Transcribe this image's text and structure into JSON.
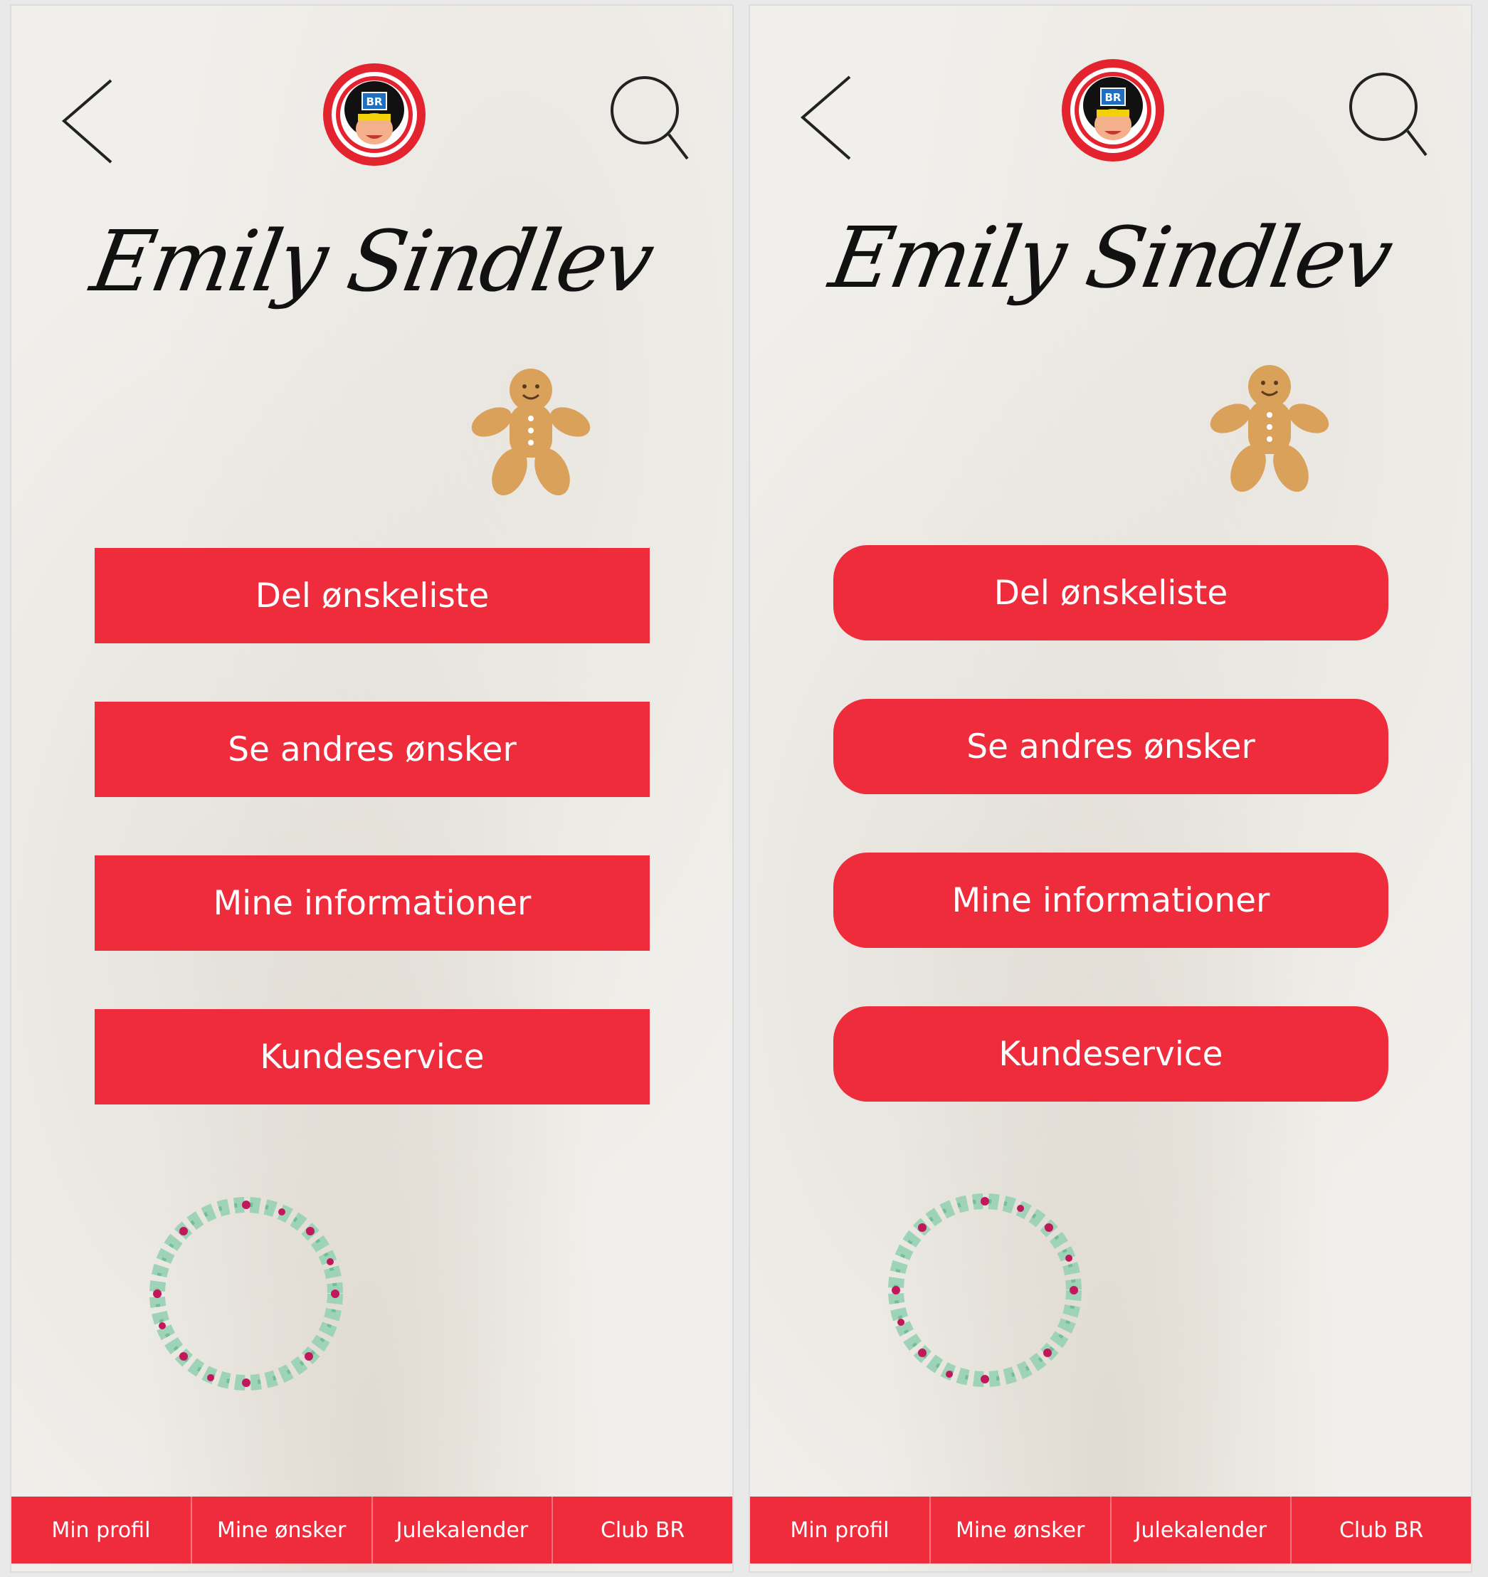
{
  "colors": {
    "brand_red": "#ee2c3c",
    "button_text": "#ffffff",
    "background": "#f1efeb"
  },
  "screens": [
    {
      "variant": "square-buttons",
      "header": {
        "back_icon": "chevron-left-icon",
        "logo": "br-mascot-logo",
        "logo_text": "BR",
        "search_icon": "search-icon"
      },
      "profile": {
        "name": "Emily Sindlev",
        "decoration_top": "gingerbread-man",
        "decoration_bottom": "christmas-wreath"
      },
      "menu": [
        {
          "label": "Del ønskeliste"
        },
        {
          "label": "Se andres ønsker"
        },
        {
          "label": "Mine informationer"
        },
        {
          "label": "Kundeservice"
        }
      ],
      "tabs": [
        {
          "label": "Min profil"
        },
        {
          "label": "Mine ønsker"
        },
        {
          "label": "Julekalender"
        },
        {
          "label": "Club BR"
        }
      ]
    },
    {
      "variant": "rounded-buttons",
      "header": {
        "back_icon": "chevron-left-icon",
        "logo": "br-mascot-logo",
        "logo_text": "BR",
        "search_icon": "search-icon"
      },
      "profile": {
        "name": "Emily Sindlev",
        "decoration_top": "gingerbread-man",
        "decoration_bottom": "christmas-wreath"
      },
      "menu": [
        {
          "label": "Del ønskeliste"
        },
        {
          "label": "Se andres ønsker"
        },
        {
          "label": "Mine informationer"
        },
        {
          "label": "Kundeservice"
        }
      ],
      "tabs": [
        {
          "label": "Min profil"
        },
        {
          "label": "Mine ønsker"
        },
        {
          "label": "Julekalender"
        },
        {
          "label": "Club BR"
        }
      ]
    }
  ]
}
